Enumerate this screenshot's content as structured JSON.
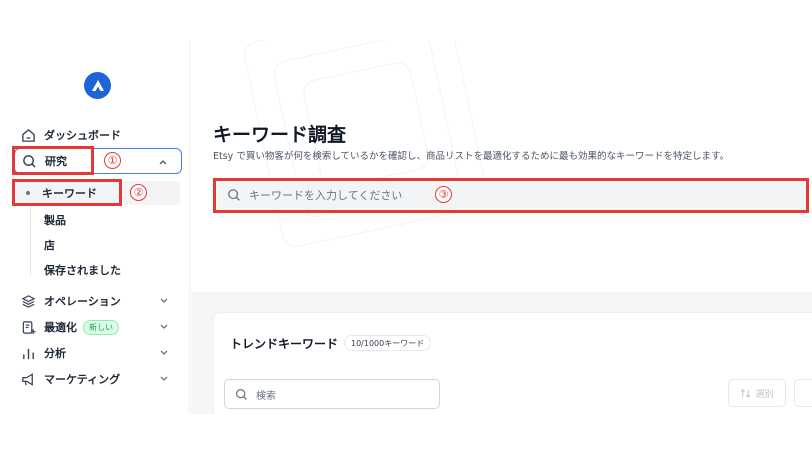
{
  "sidebar": {
    "items": {
      "dashboard": "ダッシュボード",
      "research": "研究",
      "operation": "オペレーション",
      "optimize": "最適化",
      "optimize_badge": "新しい",
      "analysis": "分析",
      "marketing": "マーケティング"
    },
    "research_sub": {
      "keyword": "キーワード",
      "product": "製品",
      "shop": "店",
      "saved": "保存されました"
    }
  },
  "annotations": {
    "n1": "①",
    "n2": "②",
    "n3": "③"
  },
  "main": {
    "title": "キーワード調査",
    "subtitle": "Etsy で買い物客が何を検索しているかを確認し、商品リストを最適化するために最も効果的なキーワードを特定します。",
    "keyword_search_placeholder": "キーワードを入力してください",
    "trend": {
      "title": "トレンドキーワード",
      "count_badge": "10/1000キーワード",
      "search_placeholder": "検索",
      "select_label": "選別"
    }
  },
  "colors": {
    "accent": "#1f63d8",
    "annotation": "#e53935",
    "active_border": "#3b82f6"
  }
}
